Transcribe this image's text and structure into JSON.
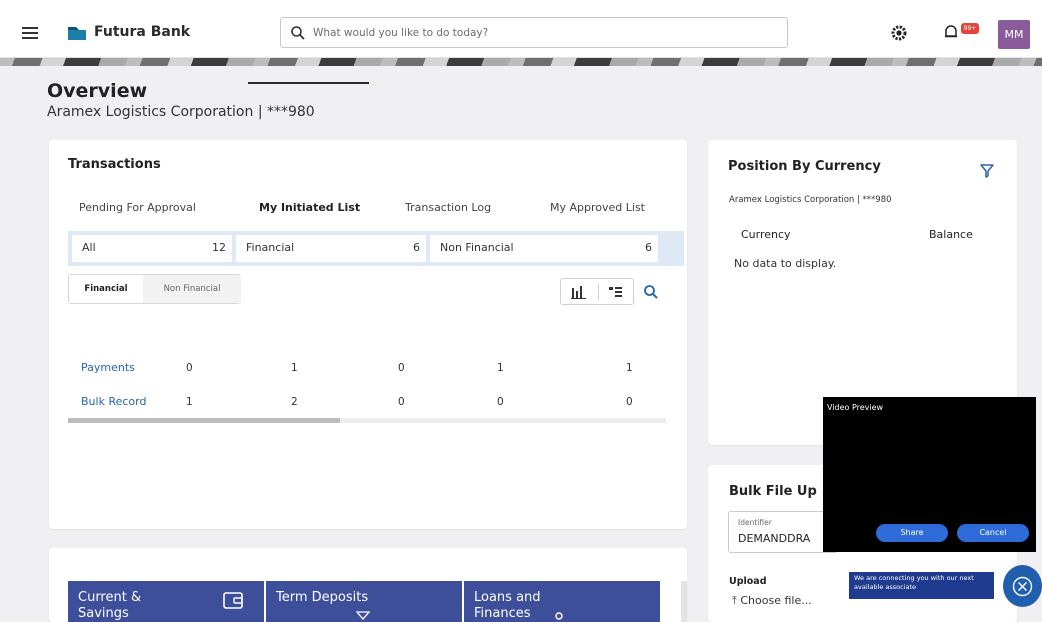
{
  "header": {
    "brand": "Futura Bank",
    "search_placeholder": "What would you like to do today?",
    "notification_badge": "99+",
    "avatar_initials": "MM"
  },
  "overview": {
    "title": "Overview",
    "subtitle": "Aramex Logistics Corporation | ***980"
  },
  "transactions": {
    "title": "Transactions",
    "tabs": [
      "Pending For Approval",
      "My Initiated List",
      "Transaction Log",
      "My Approved List"
    ],
    "active_tab": "My Initiated List",
    "summary": [
      {
        "label": "All",
        "count": "12"
      },
      {
        "label": "Financial",
        "count": "6"
      },
      {
        "label": "Non Financial",
        "count": "6"
      }
    ],
    "toggles": [
      "Financial",
      "Non Financial"
    ],
    "active_toggle": "Financial",
    "rows": [
      {
        "label": "Payments",
        "values": [
          "0",
          "1",
          "0",
          "1",
          "1"
        ]
      },
      {
        "label": "Bulk Record",
        "values": [
          "1",
          "2",
          "0",
          "0",
          "0"
        ]
      }
    ]
  },
  "position": {
    "title": "Position By Currency",
    "subtitle": "Aramex Logistics Corporation | ***980",
    "col_currency": "Currency",
    "col_balance": "Balance",
    "empty_text": "No data to display."
  },
  "bulk": {
    "title": "Bulk File Up",
    "identifier_label": "Identifier",
    "identifier_value": "DEMANDDRA",
    "upload_label": "Upload",
    "choose_file": "Choose file..."
  },
  "accounts": {
    "tiles": [
      {
        "label_line1": "Current &",
        "label_line2": "Savings"
      },
      {
        "label_line1": "Term Deposits",
        "label_line2": ""
      },
      {
        "label_line1": "Loans and",
        "label_line2": "Finances"
      }
    ]
  },
  "video": {
    "title": "Video Preview",
    "share_label": "Share",
    "cancel_label": "Cancel",
    "connecting_text": "We are connecting you with our next available associate"
  },
  "colors": {
    "accent": "#2866a8",
    "tile_bg": "#3d4f9a",
    "avatar_bg": "#8a5b9a",
    "badge": "#e2453c"
  }
}
